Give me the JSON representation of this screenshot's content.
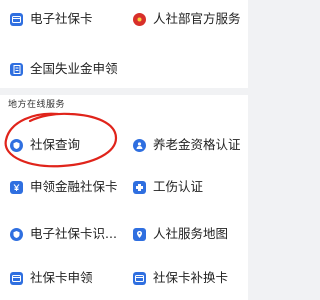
{
  "top_services": {
    "electronic_card": "电子社保卡",
    "ministry_service": "人社部官方服务",
    "unemployment_apply": "全国失业金申领"
  },
  "local_section": {
    "title": "地方在线服务",
    "items": [
      {
        "label": "社保查询",
        "icon": "shield-icon"
      },
      {
        "label": "养老金资格认证",
        "icon": "person-check-icon"
      },
      {
        "label": "申领金融社保卡",
        "icon": "yen-card-icon"
      },
      {
        "label": "工伤认证",
        "icon": "bandage-icon"
      },
      {
        "label": "电子社保卡识...",
        "icon": "shield-icon"
      },
      {
        "label": "人社服务地图",
        "icon": "map-pin-icon"
      },
      {
        "label": "社保卡申领",
        "icon": "card-icon"
      },
      {
        "label": "社保卡补换卡",
        "icon": "card-icon"
      }
    ]
  },
  "colors": {
    "accent": "#2f6fe0",
    "ministry_red": "#d8302a",
    "annotation_red": "#e0241b"
  }
}
